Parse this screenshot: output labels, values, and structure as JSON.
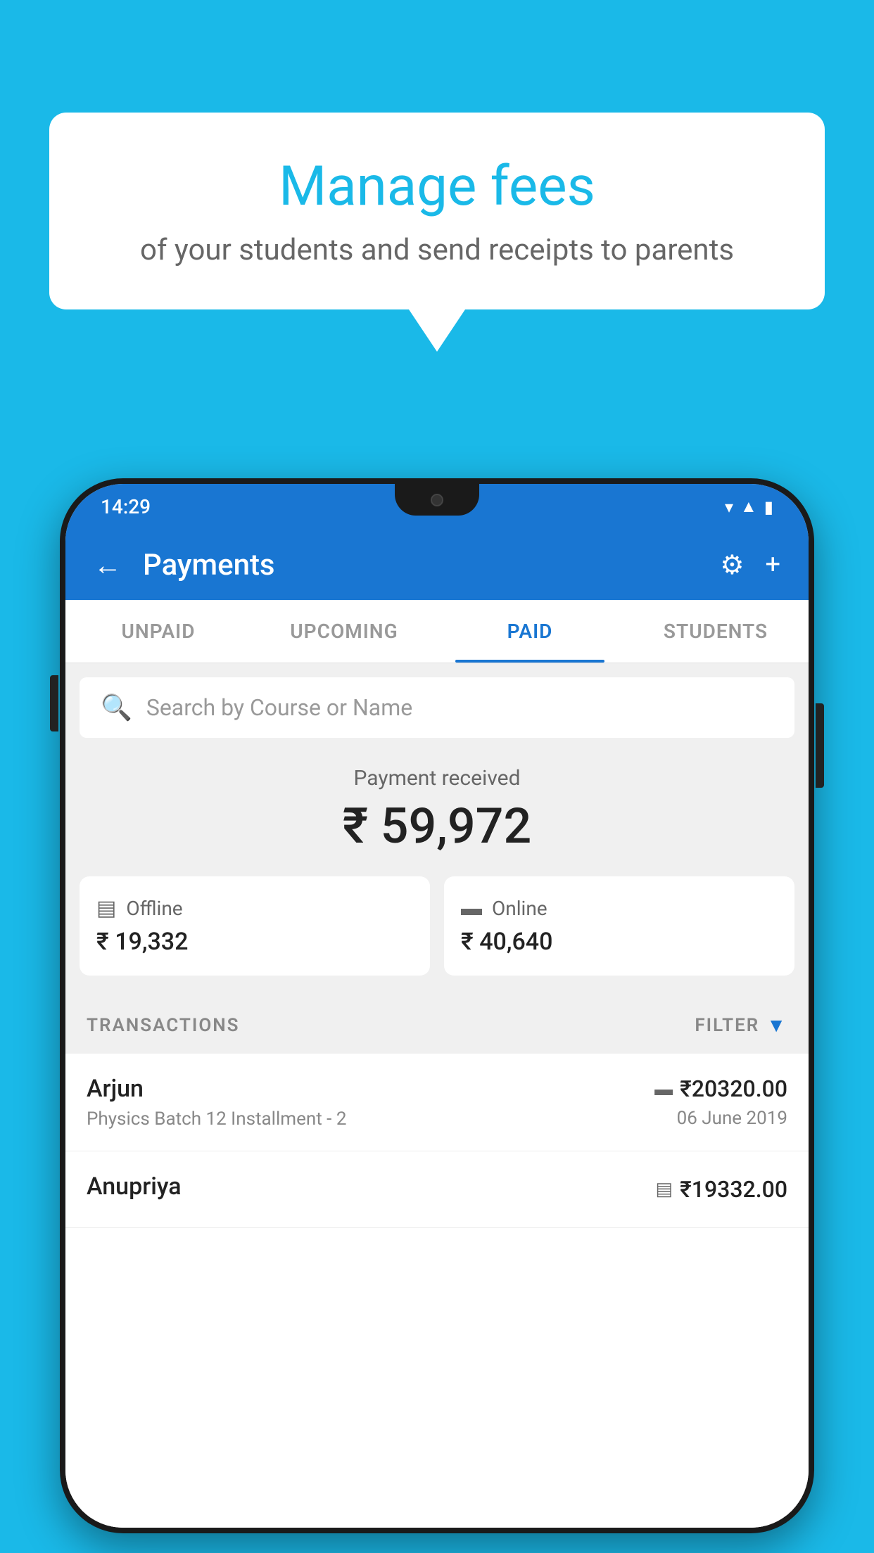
{
  "background_color": "#1ab9e8",
  "speech_bubble": {
    "title": "Manage fees",
    "subtitle": "of your students and send receipts to parents"
  },
  "phone": {
    "status_bar": {
      "time": "14:29",
      "icons": [
        "wifi",
        "signal",
        "battery"
      ]
    },
    "app_bar": {
      "title": "Payments",
      "back_label": "←",
      "settings_label": "⚙",
      "add_label": "+"
    },
    "tabs": [
      {
        "label": "UNPAID",
        "active": false
      },
      {
        "label": "UPCOMING",
        "active": false
      },
      {
        "label": "PAID",
        "active": true
      },
      {
        "label": "STUDENTS",
        "active": false
      }
    ],
    "search": {
      "placeholder": "Search by Course or Name"
    },
    "payment_summary": {
      "received_label": "Payment received",
      "total_amount": "₹ 59,972",
      "offline": {
        "label": "Offline",
        "amount": "₹ 19,332"
      },
      "online": {
        "label": "Online",
        "amount": "₹ 40,640"
      }
    },
    "transactions_section": {
      "header_label": "TRANSACTIONS",
      "filter_label": "FILTER"
    },
    "transactions": [
      {
        "name": "Arjun",
        "course": "Physics Batch 12 Installment - 2",
        "amount": "₹20320.00",
        "date": "06 June 2019",
        "payment_type": "card"
      },
      {
        "name": "Anupriya",
        "course": "",
        "amount": "₹19332.00",
        "date": "",
        "payment_type": "cash"
      }
    ]
  }
}
